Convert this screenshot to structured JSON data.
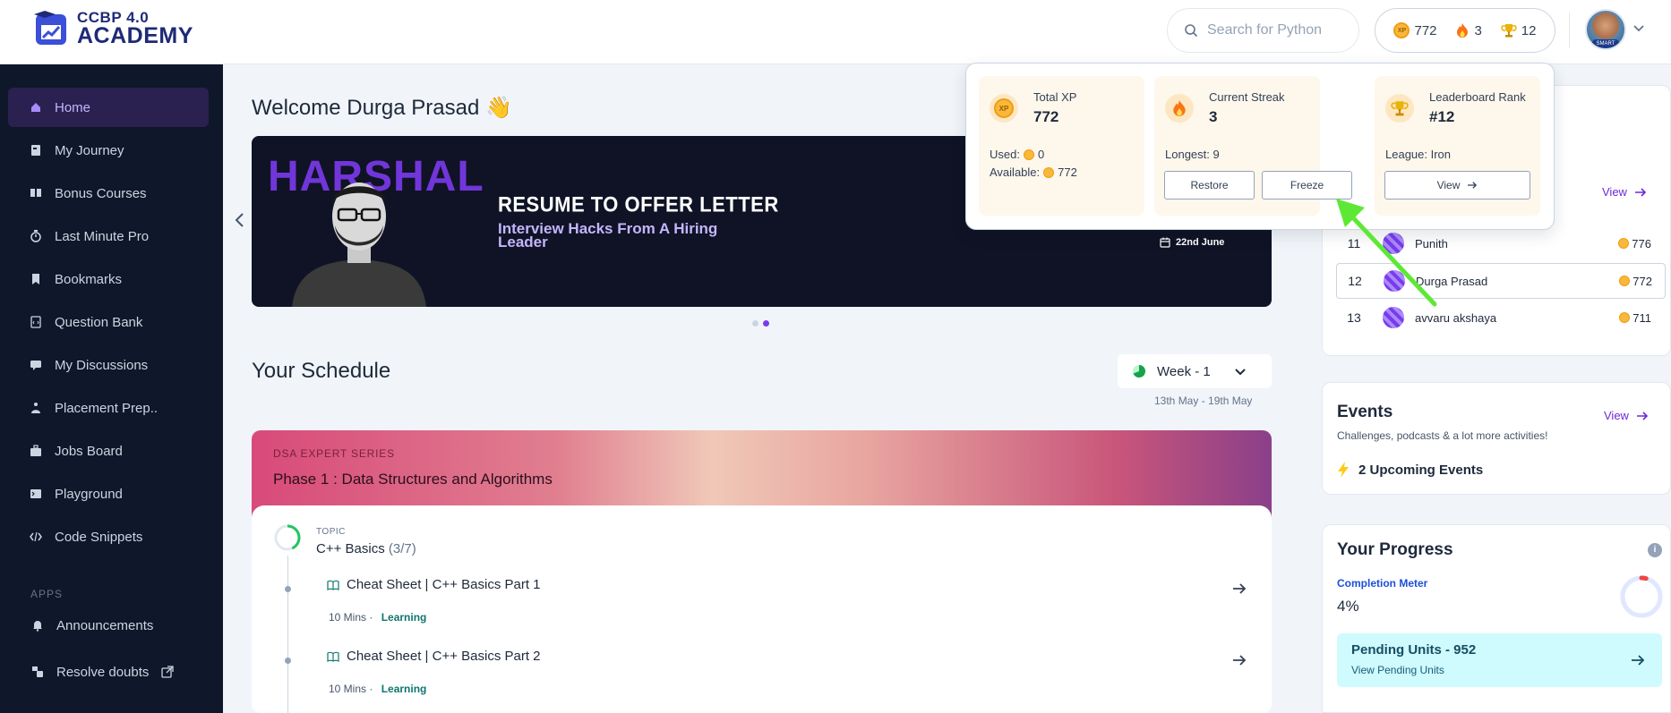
{
  "brand": {
    "line1": "CCBP 4.0",
    "line2": "ACADEMY"
  },
  "search": {
    "placeholder": "Search for Python"
  },
  "header_stats": {
    "xp": "772",
    "streak": "3",
    "rank": "12",
    "xp_icon": "xp-coin-icon",
    "streak_icon": "fire-icon",
    "rank_icon": "trophy-icon"
  },
  "avatar": {
    "badge": "SMART"
  },
  "sidebar": {
    "items": [
      {
        "label": "Home",
        "icon": "home-icon",
        "active": true
      },
      {
        "label": "My Journey",
        "icon": "journey-icon"
      },
      {
        "label": "Bonus Courses",
        "icon": "book-open-icon"
      },
      {
        "label": "Last Minute Pro",
        "icon": "stopwatch-icon"
      },
      {
        "label": "Bookmarks",
        "icon": "bookmark-icon"
      },
      {
        "label": "Question Bank",
        "icon": "code-file-icon"
      },
      {
        "label": "My Discussions",
        "icon": "chat-icon"
      },
      {
        "label": "Placement Prep..",
        "icon": "placement-icon"
      },
      {
        "label": "Jobs Board",
        "icon": "briefcase-icon"
      },
      {
        "label": "Playground",
        "icon": "terminal-icon"
      },
      {
        "label": "Code Snippets",
        "icon": "code-icon"
      }
    ],
    "apps_label": "APPS",
    "apps": [
      {
        "label": "Announcements",
        "icon": "bell-icon"
      },
      {
        "label": "Resolve doubts",
        "icon": "doubts-icon"
      }
    ]
  },
  "welcome": {
    "text": "Welcome Durga Prasad 👋"
  },
  "banner": {
    "speaker": "HARSHAL",
    "headline": "RESUME TO OFFER LETTER",
    "subline": "Interview Hacks From A Hiring Leader",
    "date": "22nd June"
  },
  "schedule": {
    "title": "Your Schedule",
    "week": "Week - 1",
    "range": "13th May - 19th May",
    "series": "DSA EXPERT SERIES",
    "phase": "Phase 1 : Data Structures and Algorithms",
    "topic_label": "TOPIC",
    "topic_name": "C++ Basics",
    "topic_progress": "(3/7)",
    "topic_fraction": 0.43,
    "items": [
      {
        "title": "Cheat Sheet | C++ Basics Part 1",
        "duration": "10 Mins",
        "type": "Learning"
      },
      {
        "title": "Cheat Sheet | C++ Basics Part 2",
        "duration": "10 Mins",
        "type": "Learning"
      }
    ]
  },
  "popup": {
    "xp": {
      "label": "Total XP",
      "value": "772",
      "used_label": "Used:",
      "used": "0",
      "available_label": "Available:",
      "available": "772"
    },
    "streak": {
      "label": "Current Streak",
      "value": "3",
      "longest": "Longest: 9",
      "restore": "Restore",
      "freeze": "Freeze"
    },
    "rank": {
      "label": "Leaderboard Rank",
      "value": "#12",
      "league": "League: Iron",
      "view": "View"
    }
  },
  "leaderboard": {
    "view": "View",
    "rows": [
      {
        "rank": "11",
        "name": "Punith",
        "xp": "776"
      },
      {
        "rank": "12",
        "name": "Durga Prasad",
        "xp": "772",
        "me": true
      },
      {
        "rank": "13",
        "name": "avvaru akshaya",
        "xp": "711"
      }
    ]
  },
  "events": {
    "title": "Events",
    "view": "View",
    "subtitle": "Challenges, podcasts & a lot more activities!",
    "upcoming": "2 Upcoming Events"
  },
  "progress": {
    "title": "Your Progress",
    "meter_label": "Completion Meter",
    "percent": "4%",
    "fraction": 0.04,
    "pending_title": "Pending Units - 952",
    "pending_link": "View Pending Units"
  },
  "colors": {
    "sidebar_bg": "#0f172a",
    "accent": "#7c3aed",
    "annotation_arrow": "#5ee836"
  }
}
